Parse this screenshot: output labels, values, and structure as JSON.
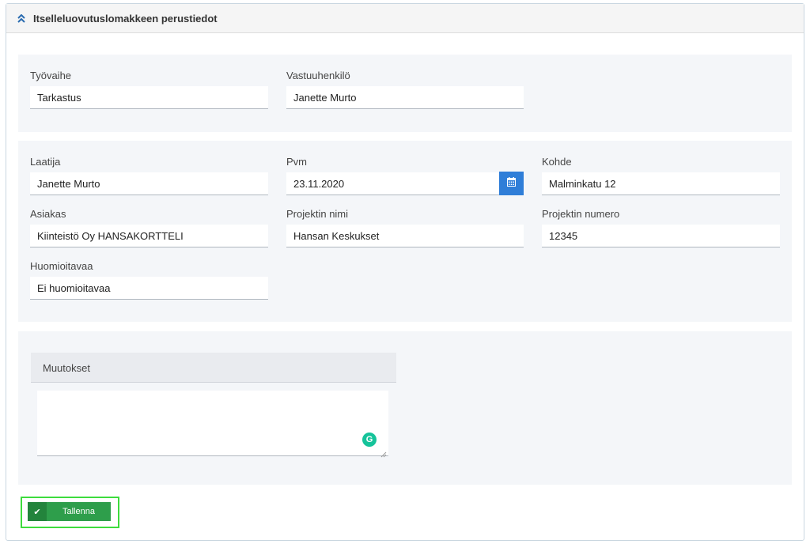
{
  "panel": {
    "title": "Itselleluovutuslomakkeen perustiedot"
  },
  "section1": {
    "tyovaihe": {
      "label": "Työvaihe",
      "value": "Tarkastus"
    },
    "vastuuhenkilo": {
      "label": "Vastuuhenkilö",
      "value": "Janette Murto"
    }
  },
  "section2": {
    "laatija": {
      "label": "Laatija",
      "value": "Janette Murto"
    },
    "pvm": {
      "label": "Pvm",
      "value": "23.11.2020"
    },
    "kohde": {
      "label": "Kohde",
      "value": "Malminkatu 12"
    },
    "asiakas": {
      "label": "Asiakas",
      "value": "Kiinteistö Oy HANSAKORTTELI"
    },
    "projektin_nimi": {
      "label": "Projektin nimi",
      "value": "Hansan Keskukset"
    },
    "projektin_numero": {
      "label": "Projektin numero",
      "value": "12345"
    },
    "huomioitavaa": {
      "label": "Huomioitavaa",
      "value": "Ei huomioitavaa"
    }
  },
  "muutokset": {
    "label": "Muutokset",
    "value": "",
    "grammarly_icon_text": "G"
  },
  "save": {
    "label": "Tallenna",
    "icon_text": "✔"
  },
  "icons": {
    "collapse": "chevrons-up-icon",
    "calendar": "calendar-icon"
  },
  "colors": {
    "accent": "#2f7ed8",
    "save": "#2e9e4b",
    "highlight": "#3ddc3d",
    "grammarly": "#15c39a"
  }
}
